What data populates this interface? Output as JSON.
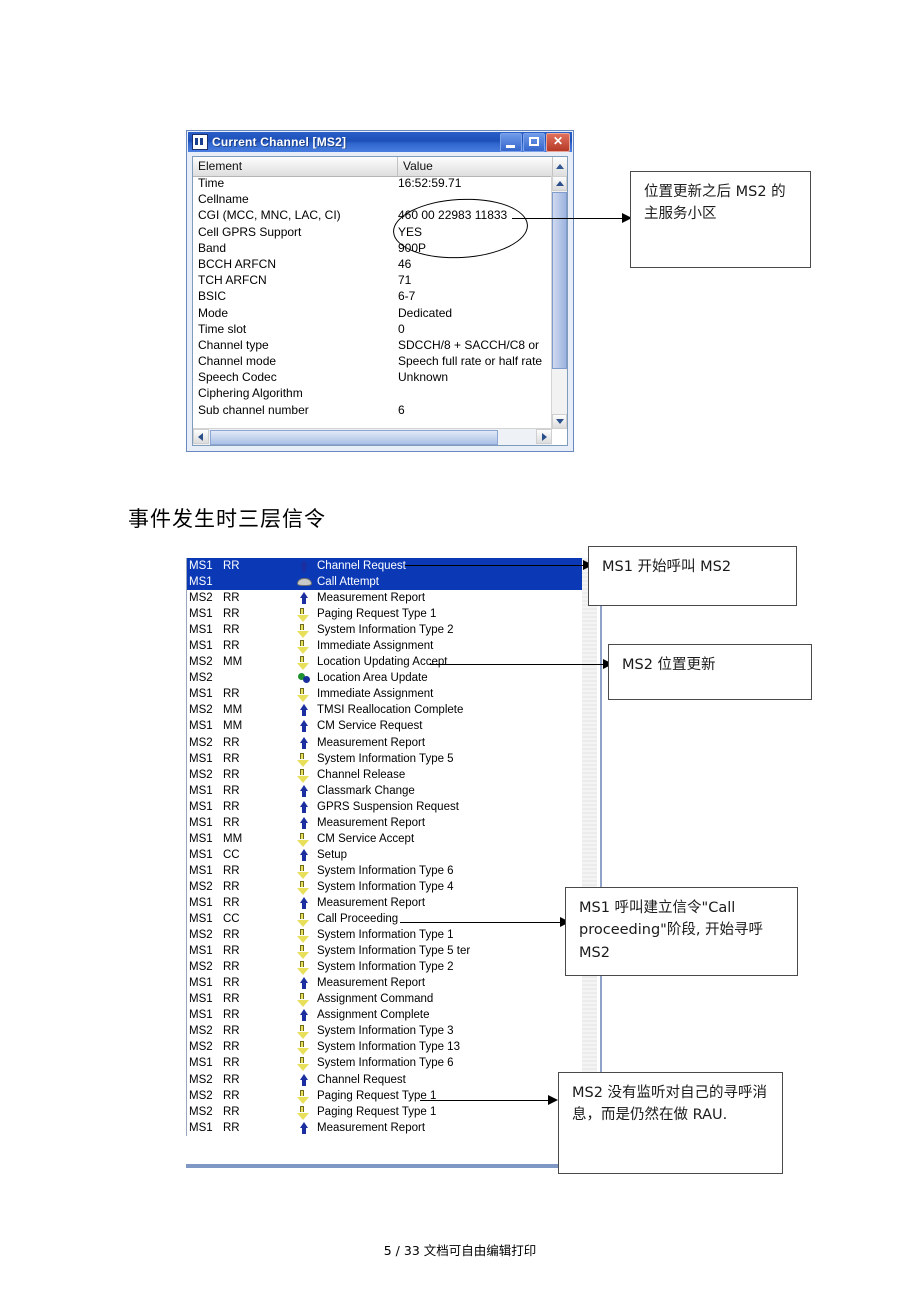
{
  "window": {
    "title": "Current Channel [MS2]",
    "icon": "table-icon",
    "buttons": {
      "minimize": "minimize-button",
      "maximize": "maximize-button",
      "close": "close-button"
    },
    "columns": {
      "element": "Element",
      "value": "Value"
    },
    "rows": [
      {
        "key": "Time",
        "value": "16:52:59.71"
      },
      {
        "key": "Cellname",
        "value": ""
      },
      {
        "key": "CGI (MCC, MNC, LAC, CI)",
        "value": "460 00 22983 11833"
      },
      {
        "key": "Cell GPRS Support",
        "value": "YES"
      },
      {
        "key": "Band",
        "value": "900P"
      },
      {
        "key": "BCCH ARFCN",
        "value": "46"
      },
      {
        "key": "TCH ARFCN",
        "value": "71"
      },
      {
        "key": "BSIC",
        "value": "6-7"
      },
      {
        "key": "Mode",
        "value": "Dedicated"
      },
      {
        "key": "Time slot",
        "value": "0"
      },
      {
        "key": "Channel type",
        "value": "SDCCH/8 + SACCH/C8 or"
      },
      {
        "key": "Channel mode",
        "value": "Speech full rate or half rate"
      },
      {
        "key": "Speech Codec",
        "value": "Unknown"
      },
      {
        "key": "Ciphering Algorithm",
        "value": ""
      },
      {
        "key": "Sub channel number",
        "value": "6"
      }
    ]
  },
  "headline": "事件发生时三层信令",
  "callouts": {
    "cell_after_lu": "位置更新之后 MS2 的主服务小区",
    "ms1_start_call": "MS1 开始呼叫 MS2",
    "ms2_location_update": "MS2 位置更新",
    "call_proceeding": "MS1 呼叫建立信令\"Call proceeding\"阶段, 开始寻呼 MS2",
    "ms2_not_listening": "MS2 没有监听对自己的寻呼消息，而是仍然在做 RAU."
  },
  "messages": [
    {
      "ms": "MS1",
      "proto": "RR",
      "icon": "arrow-up-icon",
      "name": "Channel Request",
      "selected": true
    },
    {
      "ms": "MS1",
      "proto": "",
      "icon": "phone-icon",
      "name": "Call Attempt",
      "selected": true
    },
    {
      "ms": "MS2",
      "proto": "RR",
      "icon": "arrow-up-icon",
      "name": "Measurement Report",
      "selected": false
    },
    {
      "ms": "MS1",
      "proto": "RR",
      "icon": "arrow-down-icon",
      "name": "Paging Request Type 1",
      "selected": false
    },
    {
      "ms": "MS1",
      "proto": "RR",
      "icon": "arrow-down-icon",
      "name": "System Information Type 2",
      "selected": false
    },
    {
      "ms": "MS1",
      "proto": "RR",
      "icon": "arrow-down-icon",
      "name": "Immediate Assignment",
      "selected": false
    },
    {
      "ms": "MS2",
      "proto": "MM",
      "icon": "arrow-down-icon",
      "name": "Location Updating Accept",
      "selected": false
    },
    {
      "ms": "MS2",
      "proto": "",
      "icon": "dots-icon",
      "name": "Location Area Update",
      "selected": false
    },
    {
      "ms": "MS1",
      "proto": "RR",
      "icon": "arrow-down-icon",
      "name": "Immediate Assignment",
      "selected": false
    },
    {
      "ms": "MS2",
      "proto": "MM",
      "icon": "arrow-up-icon",
      "name": "TMSI Reallocation Complete",
      "selected": false
    },
    {
      "ms": "MS1",
      "proto": "MM",
      "icon": "arrow-up-icon",
      "name": "CM Service Request",
      "selected": false
    },
    {
      "ms": "MS2",
      "proto": "RR",
      "icon": "arrow-up-icon",
      "name": "Measurement Report",
      "selected": false
    },
    {
      "ms": "MS1",
      "proto": "RR",
      "icon": "arrow-down-icon",
      "name": "System Information Type 5",
      "selected": false
    },
    {
      "ms": "MS2",
      "proto": "RR",
      "icon": "arrow-down-icon",
      "name": "Channel Release",
      "selected": false
    },
    {
      "ms": "MS1",
      "proto": "RR",
      "icon": "arrow-up-icon",
      "name": "Classmark Change",
      "selected": false
    },
    {
      "ms": "MS1",
      "proto": "RR",
      "icon": "arrow-up-icon",
      "name": "GPRS Suspension Request",
      "selected": false
    },
    {
      "ms": "MS1",
      "proto": "RR",
      "icon": "arrow-up-icon",
      "name": "Measurement Report",
      "selected": false
    },
    {
      "ms": "MS1",
      "proto": "MM",
      "icon": "arrow-down-icon",
      "name": "CM Service Accept",
      "selected": false
    },
    {
      "ms": "MS1",
      "proto": "CC",
      "icon": "arrow-up-icon",
      "name": "Setup",
      "selected": false
    },
    {
      "ms": "MS1",
      "proto": "RR",
      "icon": "arrow-down-icon",
      "name": "System Information Type 6",
      "selected": false
    },
    {
      "ms": "MS2",
      "proto": "RR",
      "icon": "arrow-down-icon",
      "name": "System Information Type 4",
      "selected": false
    },
    {
      "ms": "MS1",
      "proto": "RR",
      "icon": "arrow-up-icon",
      "name": "Measurement Report",
      "selected": false
    },
    {
      "ms": "MS1",
      "proto": "CC",
      "icon": "arrow-down-icon",
      "name": "Call Proceeding",
      "selected": false
    },
    {
      "ms": "MS2",
      "proto": "RR",
      "icon": "arrow-down-icon",
      "name": "System Information Type 1",
      "selected": false
    },
    {
      "ms": "MS1",
      "proto": "RR",
      "icon": "arrow-down-icon",
      "name": "System Information Type 5 ter",
      "selected": false
    },
    {
      "ms": "MS2",
      "proto": "RR",
      "icon": "arrow-down-icon",
      "name": "System Information Type 2",
      "selected": false
    },
    {
      "ms": "MS1",
      "proto": "RR",
      "icon": "arrow-up-icon",
      "name": "Measurement Report",
      "selected": false
    },
    {
      "ms": "MS1",
      "proto": "RR",
      "icon": "arrow-down-icon",
      "name": "Assignment Command",
      "selected": false
    },
    {
      "ms": "MS1",
      "proto": "RR",
      "icon": "arrow-up-icon",
      "name": "Assignment Complete",
      "selected": false
    },
    {
      "ms": "MS2",
      "proto": "RR",
      "icon": "arrow-down-icon",
      "name": "System Information Type 3",
      "selected": false
    },
    {
      "ms": "MS2",
      "proto": "RR",
      "icon": "arrow-down-icon",
      "name": "System Information Type 13",
      "selected": false
    },
    {
      "ms": "MS1",
      "proto": "RR",
      "icon": "arrow-down-icon",
      "name": "System Information Type 6",
      "selected": false
    },
    {
      "ms": "MS2",
      "proto": "RR",
      "icon": "arrow-up-icon",
      "name": "Channel Request",
      "selected": false
    },
    {
      "ms": "MS2",
      "proto": "RR",
      "icon": "arrow-down-icon",
      "name": "Paging Request Type 1",
      "selected": false
    },
    {
      "ms": "MS2",
      "proto": "RR",
      "icon": "arrow-down-icon",
      "name": "Paging Request Type 1",
      "selected": false
    },
    {
      "ms": "MS1",
      "proto": "RR",
      "icon": "arrow-up-icon",
      "name": "Measurement Report",
      "selected": false
    }
  ],
  "footer": "5 / 33 文档可自由编辑打印"
}
